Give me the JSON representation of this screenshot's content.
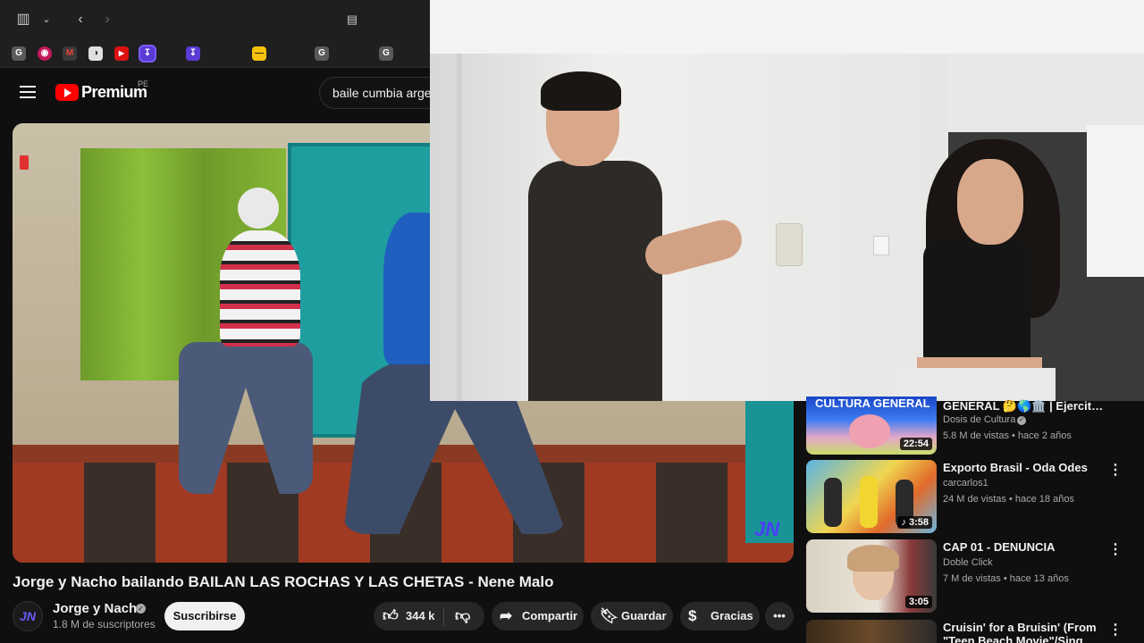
{
  "browser": {
    "tab_icons": [
      "G",
      "◉",
      "M",
      "◑",
      "▶",
      "↧",
      "↧",
      "—",
      "G",
      "G"
    ]
  },
  "header": {
    "logo_text": "Premium",
    "country_code": "PE",
    "search_value": "baile cumbia arge"
  },
  "video": {
    "title": "Jorge y Nacho bailando BAILAN LAS ROCHAS Y LAS CHETAS - Nene Malo",
    "watermark": "JN",
    "channel": {
      "name": "Jorge y Nacho",
      "subscribers": "1.8 M de suscriptores",
      "avatar_text": "JN"
    },
    "subscribe_label": "Suscribirse",
    "likes": "344 k",
    "share_label": "Compartir",
    "save_label": "Guardar",
    "thanks_label": "Gracias"
  },
  "recommendations": [
    {
      "title": "GENERAL 🤔🌎🏛️ | Ejercita t...",
      "thumb_text": "CULTURA GENERAL",
      "channel": "Dosis de Cultura",
      "verified": true,
      "meta": "5.8 M de vistas • hace 2 años",
      "duration": "22:54"
    },
    {
      "title": "Exporto Brasil - Oda Odes",
      "channel": "carcarlos1",
      "verified": false,
      "meta": "24 M de vistas • hace 18 años",
      "duration": "♪ 3:58"
    },
    {
      "title": "CAP 01 - DENUNCIA",
      "channel": "Doble Click",
      "verified": false,
      "meta": "7 M de vistas • hace 13 años",
      "duration": "3:05"
    },
    {
      "title": "Cruisin' for a Bruisin' (From",
      "subtitle": "\"Teen Beach Movie\"/Sing...",
      "channel": "",
      "meta": "",
      "duration": ""
    }
  ],
  "colors": {
    "background": "#0f0f0f",
    "brand_red": "#ff0000",
    "pill_bg": "#272727",
    "secondary_text": "#aaaaaa"
  }
}
